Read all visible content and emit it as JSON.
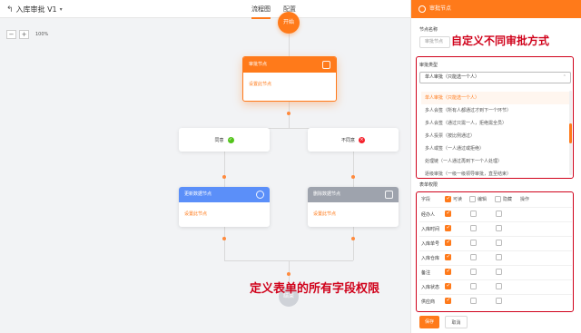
{
  "header": {
    "title": "入库审批 V1",
    "tabs": [
      {
        "label": "流程图",
        "active": true
      },
      {
        "label": "配置",
        "active": false
      }
    ]
  },
  "zoom": {
    "minus": "−",
    "plus": "+",
    "level": "100%"
  },
  "flow": {
    "start_label": "开始",
    "end_label": "结束",
    "approve_node": {
      "title": "审批节点",
      "body": "设置此节点"
    },
    "conditions": [
      {
        "label": "同意",
        "status": "ok"
      },
      {
        "label": "不同意",
        "status": "no"
      }
    ],
    "update_node": {
      "title": "更新数据节点",
      "body": "设置此节点"
    },
    "delete_node": {
      "title": "删除数据节点",
      "body": "设置此节点"
    }
  },
  "annotations": {
    "fields": "定义表单的所有字段权限",
    "approval": "自定义不同审批方式"
  },
  "panel": {
    "title": "审批节点",
    "node_name_label": "节点名称",
    "node_name_value": "审批节点",
    "approval_type_label": "审批类型",
    "approval_type_value": "单人审批（只能选一个人）",
    "options": [
      "单人审批（只能选一个人）",
      "多人会签（所有人都通过才到下一个环节）",
      "多人会签（通过只需一人，拒绝需全员）",
      "多人投票（按比例通过）",
      "多人或签（一人通过或拒绝）",
      "处理链（一人通过再到下一个人处理）",
      "逐级审批（一级一级领导审批，直至结束）"
    ],
    "permissions_label": "表单权限",
    "columns": {
      "field": "字段",
      "visible": "可读",
      "edit": "编辑",
      "hidden": "隐藏",
      "action": "操作"
    },
    "rows": [
      {
        "name": "经办人"
      },
      {
        "name": "入库时间"
      },
      {
        "name": "入库单号"
      },
      {
        "name": "入库仓库"
      },
      {
        "name": "备注"
      },
      {
        "name": "入库状态"
      },
      {
        "name": "供应商"
      }
    ],
    "save_label": "保存",
    "cancel_label": "取消"
  },
  "colors": {
    "accent": "#ff7a1a",
    "annotation": "#d0021b",
    "update": "#5b8ff9",
    "delete": "#9ea3ad",
    "ok": "#52c41a",
    "no": "#f5222d"
  }
}
